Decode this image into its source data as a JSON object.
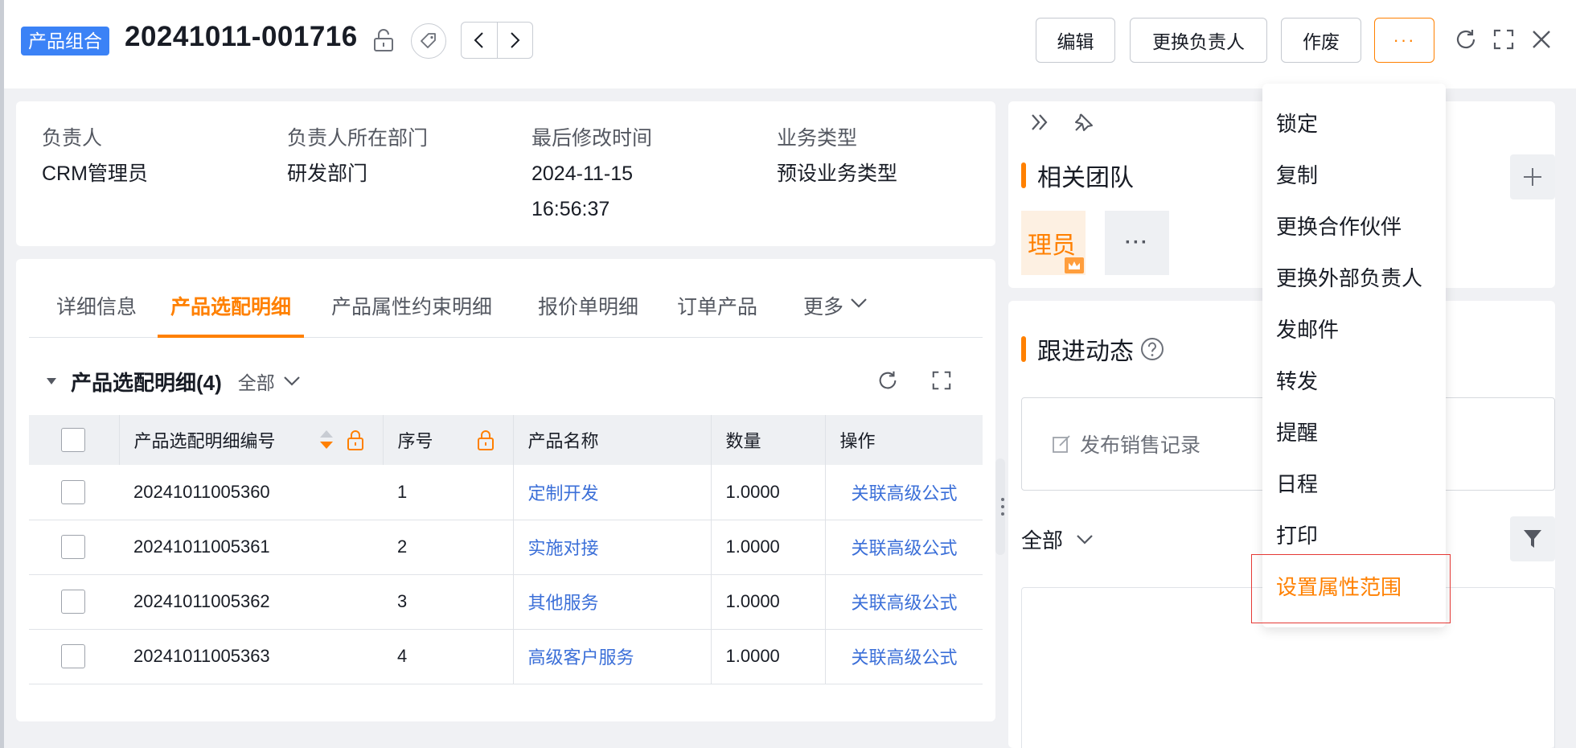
{
  "header": {
    "type_tag": "产品组合",
    "record_id": "20241011-001716",
    "buttons": {
      "edit": "编辑",
      "change_owner": "更换负责人",
      "void": "作废",
      "more": "···"
    }
  },
  "summary": {
    "fields": [
      {
        "label": "负责人",
        "value": "CRM管理员"
      },
      {
        "label": "负责人所在部门",
        "value": "研发部门"
      },
      {
        "label": "最后修改时间",
        "value_line1": "2024-11-15",
        "value_line2": "16:56:37"
      },
      {
        "label": "业务类型",
        "value": "预设业务类型"
      }
    ]
  },
  "tabs": [
    {
      "label": "详细信息",
      "active": false
    },
    {
      "label": "产品选配明细",
      "active": true
    },
    {
      "label": "产品属性约束明细",
      "active": false
    },
    {
      "label": "报价单明细",
      "active": false
    },
    {
      "label": "订单产品",
      "active": false
    },
    {
      "label": "更多",
      "active": false
    }
  ],
  "section": {
    "title": "产品选配明细(4)",
    "filter": "全部"
  },
  "table": {
    "columns": [
      "产品选配明细编号",
      "序号",
      "产品名称",
      "数量",
      "操作"
    ],
    "rows": [
      {
        "code": "20241011005360",
        "seq": "1",
        "product": "定制开发",
        "qty": "1.0000",
        "action": "关联高级公式"
      },
      {
        "code": "20241011005361",
        "seq": "2",
        "product": "实施对接",
        "qty": "1.0000",
        "action": "关联高级公式"
      },
      {
        "code": "20241011005362",
        "seq": "3",
        "product": "其他服务",
        "qty": "1.0000",
        "action": "关联高级公式"
      },
      {
        "code": "20241011005363",
        "seq": "4",
        "product": "高级客户服务",
        "qty": "1.0000",
        "action": "关联高级公式"
      }
    ]
  },
  "right_panel": {
    "team_title": "相关团队",
    "team_member_text": "理员",
    "team_more": "···",
    "follow_title": "跟进动态",
    "compose_placeholder": "发布销售记录",
    "follow_filter": "全部"
  },
  "more_menu": {
    "items": [
      "锁定",
      "复制",
      "更换合作伙伴",
      "更换外部负责人",
      "发邮件",
      "转发",
      "提醒",
      "日程",
      "打印",
      "设置属性范围"
    ],
    "highlighted": "设置属性范围"
  },
  "colors": {
    "accent": "#ff8000",
    "tag_blue": "#3b82f6",
    "link": "#3b6fd8",
    "highlight_outline": "#e53935"
  }
}
